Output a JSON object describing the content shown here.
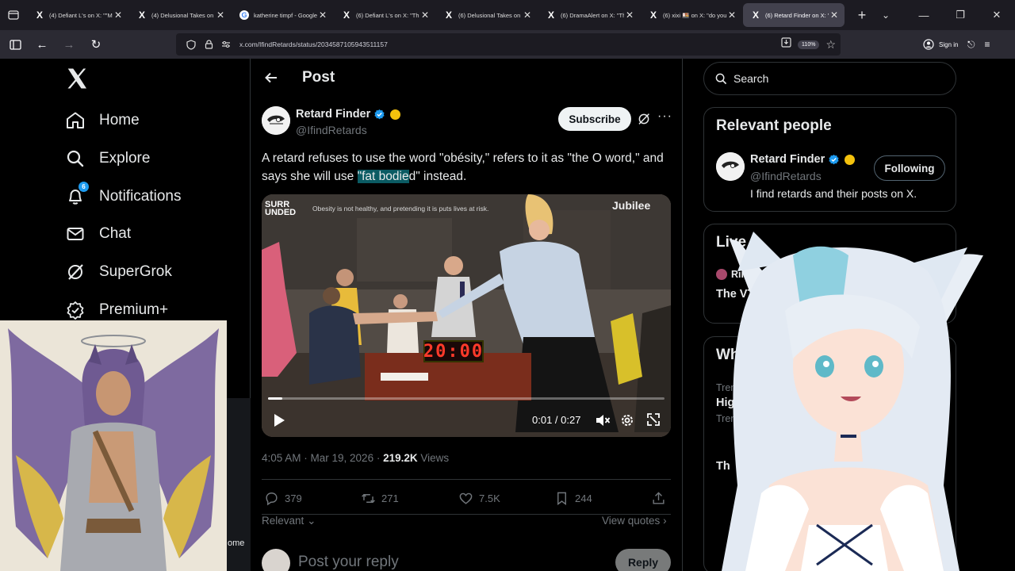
{
  "browser": {
    "tabs": [
      {
        "title": "(4) Defiant L's on X: \"\"Ma",
        "favicon": "x",
        "active": false
      },
      {
        "title": "(4) Delusional Takes on X",
        "favicon": "x",
        "active": false
      },
      {
        "title": "katherine timpf - Google",
        "favicon": "google",
        "active": false
      },
      {
        "title": "(6) Defiant L's on X: \"Th",
        "favicon": "x",
        "active": false
      },
      {
        "title": "(6) Delusional Takes on X",
        "favicon": "x",
        "active": false
      },
      {
        "title": "(6) DramaAlert on X: \"Th",
        "favicon": "x",
        "active": false
      },
      {
        "title": "(6) xixi 🍱 on X: \"do you",
        "favicon": "x",
        "active": false
      },
      {
        "title": "(6) Retard Finder on X: \"A",
        "favicon": "x",
        "active": true
      }
    ],
    "url": "x.com/IfindRetards/status/2034587105943511157",
    "zoom": "110%",
    "sign_in": "Sign in"
  },
  "nav": {
    "items": [
      {
        "label": "Home",
        "icon": "home-icon"
      },
      {
        "label": "Explore",
        "icon": "search-icon"
      },
      {
        "label": "Notifications",
        "icon": "bell-icon",
        "badge": "6"
      },
      {
        "label": "Chat",
        "icon": "mail-icon"
      },
      {
        "label": "SuperGrok",
        "icon": "grok-icon"
      },
      {
        "label": "Premium+",
        "icon": "premium-icon"
      }
    ],
    "fragment_text": "ome"
  },
  "post": {
    "header_title": "Post",
    "author": {
      "name": "Retard Finder",
      "handle": "@IfindRetards"
    },
    "subscribe_label": "Subscribe",
    "more_label": "···",
    "text_before": "A retard refuses to use the word \"obésity,\" refers to it as \"the O word,\" and says she will use ",
    "text_highlight": "\"fat bodie",
    "text_after": "d\" instead.",
    "video": {
      "brand_left_line1": "SURR",
      "brand_left_line2": "UNDED",
      "caption": "Obesity is not healthy, and pretending it is puts lives at risk.",
      "brand_right": "Jubilee",
      "timer": "20:00",
      "time": "0:01 / 0:27",
      "progress_fraction": 0.037
    },
    "timestamp": "4:05 AM · Mar 19, 2026 · ",
    "views_count": "219.2K",
    "views_label": " Views",
    "stats": {
      "replies": "379",
      "reposts": "271",
      "likes": "7.5K",
      "bookmarks": "244"
    },
    "sort_label": "Relevant",
    "view_quotes": "View quotes",
    "reply_placeholder": "Post your reply",
    "reply_button": "Reply"
  },
  "sidebar": {
    "search_placeholder": "Search",
    "relevant_people": {
      "title": "Relevant people",
      "name": "Retard Finder",
      "handle": "@IfindRetards",
      "bio": "I find retards and their posts on X.",
      "follow_label": "Following"
    },
    "live": {
      "title": "Live o",
      "host": "Rima Evenst",
      "stream_title": "The VTUBER"
    },
    "whats_happening": {
      "title": "What's h",
      "trends": [
        {
          "meta": "Trending i",
          "name": "High P"
        },
        {
          "meta": "Trending v",
          "name": ""
        },
        {
          "meta": "",
          "name": "Th"
        }
      ]
    }
  },
  "colors": {
    "accent": "#1d9bf0",
    "highlight": "#0b5b63",
    "timer": "#ff3a2a"
  }
}
